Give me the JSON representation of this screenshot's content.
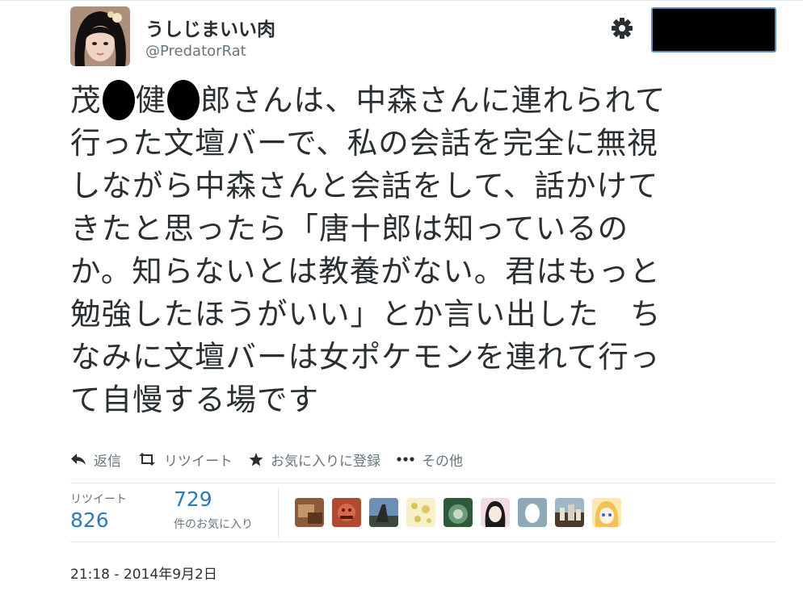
{
  "user": {
    "display_name": "うしじまいい肉",
    "handle": "@PredatorRat"
  },
  "header": {
    "gear_icon": "gear-icon",
    "follow_button": "redacted-black-box"
  },
  "tweet": {
    "lines": [
      [
        "茂",
        "健",
        "郎さんは、中森さんに連れられて"
      ],
      "行った文壇バーで、私の会話を完全に無視",
      "しながら中森さんと会話をして、話かけて",
      "きたと思ったら「唐十郎は知っているの",
      "か。知らないとは教養がない。君はもっと",
      "勉強したほうがいい」とか言い出した　ち",
      "なみに文壇バーは女ポケモンを連れて行っ",
      "て自慢する場です"
    ]
  },
  "actions": [
    {
      "icon": "reply-icon",
      "label": "返信"
    },
    {
      "icon": "retweet-icon",
      "label": "リツイート"
    },
    {
      "icon": "star-icon",
      "label": "お気に入りに登録"
    },
    {
      "icon": "more-icon",
      "label": "その他"
    }
  ],
  "stats": {
    "retweets_label": "リツイート",
    "retweets_value": "826",
    "favorites_value": "729",
    "favorites_label": "件のお気に入り"
  },
  "favoriters": [
    {
      "name": "avatar-1",
      "color": "#8a5a3a"
    },
    {
      "name": "avatar-2",
      "color": "#b04a30"
    },
    {
      "name": "avatar-3",
      "color": "#3a5f8a"
    },
    {
      "name": "avatar-4",
      "color": "#f2e6a0"
    },
    {
      "name": "avatar-5",
      "color": "#3e6b4a"
    },
    {
      "name": "avatar-6",
      "color": "#e8b7c8"
    },
    {
      "name": "avatar-7",
      "color": "#7f98a8"
    },
    {
      "name": "avatar-8",
      "color": "#6b5a45"
    },
    {
      "name": "avatar-9",
      "color": "#f4d27a"
    }
  ],
  "timestamp": "21:18 - 2014年9月2日",
  "colors": {
    "text": "#292f33",
    "muted": "#66757f",
    "link": "#2b7bb9",
    "border": "#e1e8ed"
  }
}
